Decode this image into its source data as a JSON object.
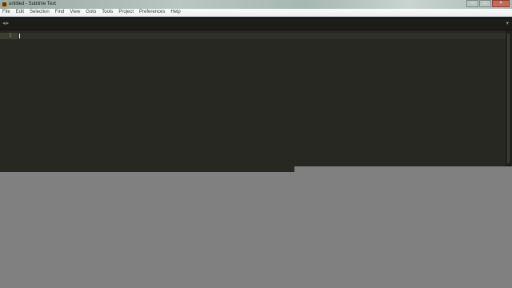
{
  "window": {
    "title": "untitled - Sublime Text",
    "controls": {
      "minimize": "–",
      "maximize": "□",
      "close": "×"
    }
  },
  "menu": {
    "items": [
      {
        "label": "File"
      },
      {
        "label": "Edit"
      },
      {
        "label": "Selection"
      },
      {
        "label": "Find"
      },
      {
        "label": "View"
      },
      {
        "label": "Goto"
      },
      {
        "label": "Tools"
      },
      {
        "label": "Project"
      },
      {
        "label": "Preferences"
      },
      {
        "label": "Help"
      }
    ]
  },
  "tabbar": {
    "nav_glyphs": "◂▸",
    "dropdown_glyph": "▾"
  },
  "editor": {
    "line_numbers": [
      "1"
    ],
    "content": ""
  },
  "colors": {
    "editor_background": "#272822",
    "gutter_highlight": "#3e3d32",
    "tabbar_background": "#1c1c1a",
    "overlay": "#808080"
  }
}
